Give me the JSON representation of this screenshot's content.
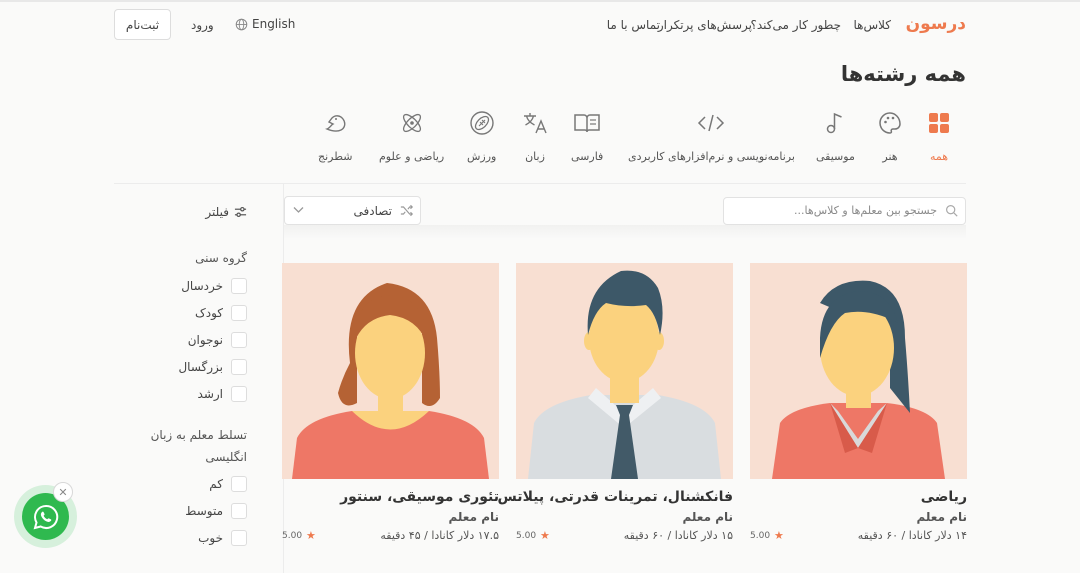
{
  "header": {
    "logo_text": "درسون",
    "nav": [
      "کلاس‌ها",
      "چطور کار می‌کند؟",
      "پرسش‌های پرتکرار",
      "تماس با ما"
    ],
    "signup_label": "ثبت‌نام",
    "login_label": "ورود",
    "language_label": "English"
  },
  "page_title": "همه رشته‌ها",
  "categories": [
    {
      "label": "همه",
      "icon": "grid-icon",
      "active": true
    },
    {
      "label": "هنر",
      "icon": "palette-icon"
    },
    {
      "label": "موسیقی",
      "icon": "music-note-icon"
    },
    {
      "label": "برنامه‌نویسی و نرم‌افزارهای کاربردی",
      "icon": "code-icon"
    },
    {
      "label": "فارسی",
      "icon": "book-icon"
    },
    {
      "label": "زبان",
      "icon": "translate-icon"
    },
    {
      "label": "ورزش",
      "icon": "football-icon"
    },
    {
      "label": "ریاضی و علوم",
      "icon": "atom-icon"
    },
    {
      "label": "شطرنج",
      "icon": "chess-knight-icon"
    }
  ],
  "search": {
    "placeholder": "جستجو بین معلم‌ها و کلاس‌ها..."
  },
  "sort": {
    "selected": "تصادفی"
  },
  "filters": {
    "title": "فیلتر",
    "age_group": {
      "title": "گروه سنی",
      "options": [
        "خردسال",
        "کودک",
        "نوجوان",
        "بزرگسال",
        "ارشد"
      ]
    },
    "english": {
      "title_line1": "تسلط معلم به زبان",
      "title_line2": "انگلیسی",
      "options": [
        "کم",
        "متوسط",
        "خوب"
      ]
    }
  },
  "cards": [
    {
      "title": "ریاضی",
      "teacher": "نام معلم",
      "price": "۱۴ دلار کانادا / ۶۰ دقیقه",
      "rating": "5.00"
    },
    {
      "title": "فانکشنال، تمرینات قدرتی، پیلاتس",
      "teacher": "نام معلم",
      "price": "۱۵ دلار کانادا / ۶۰ دقیقه",
      "rating": "5.00"
    },
    {
      "title": "تئوری موسیقی، سنتور",
      "teacher": "نام معلم",
      "price": "۱۷.۵ دلار کانادا / ۴۵ دقیقه",
      "rating": "5.00"
    }
  ],
  "colors": {
    "accent": "#ee7a4e",
    "whatsapp": "#2fb94f",
    "card_bg": "#f8dfd2"
  }
}
